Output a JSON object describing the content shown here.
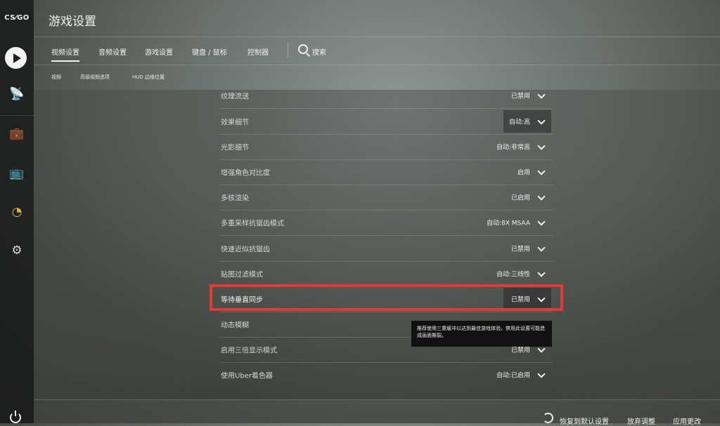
{
  "app": {
    "logo": "CS⁄GO"
  },
  "header": {
    "title": "游戏设置"
  },
  "tabs": [
    {
      "label": "视频设置",
      "active": true
    },
    {
      "label": "音频设置",
      "active": false
    },
    {
      "label": "游戏设置",
      "active": false
    },
    {
      "label": "键盘 / 鼠标",
      "active": false
    },
    {
      "label": "控制器",
      "active": false
    }
  ],
  "search": {
    "label": "搜索"
  },
  "subtabs": [
    {
      "label": "视频"
    },
    {
      "label": "高级视频选项"
    },
    {
      "label": "HUD 边缘位置"
    }
  ],
  "settings": [
    {
      "label": "纹理流送",
      "value": "已禁用"
    },
    {
      "label": "效果细节",
      "value": "自动:高"
    },
    {
      "label": "光影细节",
      "value": "自动:非常高"
    },
    {
      "label": "增强角色对比度",
      "value": "启用"
    },
    {
      "label": "多核渲染",
      "value": "已启用"
    },
    {
      "label": "多重采样抗锯齿模式",
      "value": "自动:8X MSAA"
    },
    {
      "label": "快速近似抗锯齿",
      "value": "已禁用"
    },
    {
      "label": "贴图过滤模式",
      "value": "自动:三线性"
    },
    {
      "label": "等待垂直同步",
      "value": "已禁用"
    },
    {
      "label": "动态模糊",
      "value": ""
    },
    {
      "label": "启用三倍显示模式",
      "value": "已禁用"
    },
    {
      "label": "使用Uber着色器",
      "value": "自动:已启用"
    }
  ],
  "tooltip": {
    "text": "推荐使用三重缓冲以达到最佳游戏体验。禁用此设置可能造成画面撕裂。"
  },
  "footer": {
    "reset": "恢复到默认设置",
    "discard": "放弃调整",
    "apply": "应用更改"
  },
  "colors": {
    "highlight": "#e53935"
  }
}
